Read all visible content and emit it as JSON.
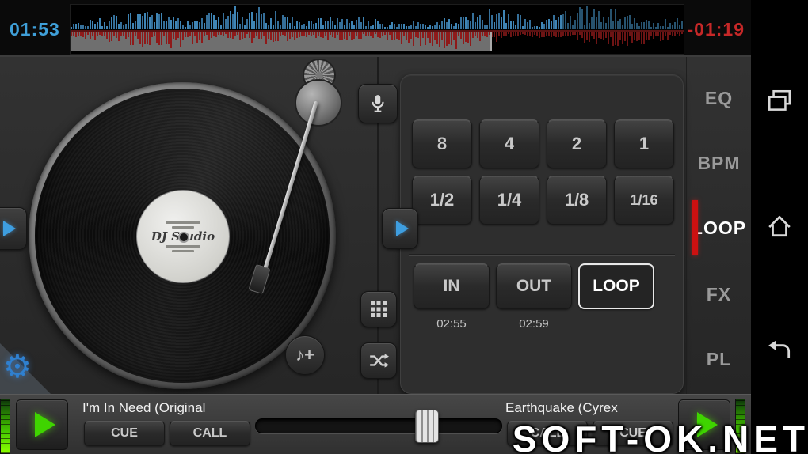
{
  "top_bar": {
    "deck_a_time": "01:53",
    "deck_b_time": "-01:19"
  },
  "deck_a": {
    "record_label_brand": "DJ Studio",
    "title": "I'm In Need (Original",
    "cue_label": "CUE",
    "call_label": "CALL"
  },
  "deck_b": {
    "title": "Earthquake (Cyrex",
    "cue_label": "CUE",
    "call_label": "CALL"
  },
  "loop_panel": {
    "beat_divisions": [
      "8",
      "4",
      "2",
      "1",
      "1/2",
      "1/4",
      "1/8",
      "1/16"
    ],
    "in_label": "IN",
    "out_label": "OUT",
    "loop_label": "LOOP",
    "in_time": "02:55",
    "out_time": "02:59"
  },
  "side_tabs": [
    {
      "label": "EQ",
      "active": false
    },
    {
      "label": "BPM",
      "active": false
    },
    {
      "label": "LOOP",
      "active": true
    },
    {
      "label": "FX",
      "active": false
    },
    {
      "label": "PL",
      "active": false
    }
  ],
  "icons": {
    "microphone": "mic",
    "pad-grid": "grid",
    "shuffle": "shuffle",
    "music_note_add": "♪+",
    "settings_gear": "⚙",
    "recents": "recent-apps",
    "home": "home",
    "back": "back"
  },
  "colors": {
    "deck_a_accent": "#3f9fd8",
    "deck_b_accent": "#c62828",
    "play_green": "#3fd400",
    "loop_active_red": "#cc1111",
    "waveform_blue": "#3f85b5",
    "waveform_red": "#8f1a1a"
  },
  "watermark": "SOFT-OK.NET"
}
